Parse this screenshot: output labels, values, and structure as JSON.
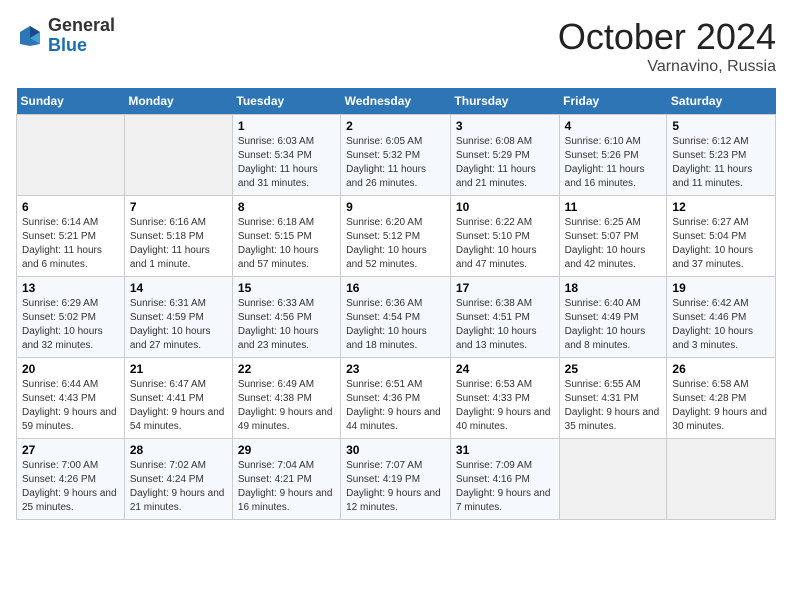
{
  "header": {
    "logo_general": "General",
    "logo_blue": "Blue",
    "month_title": "October 2024",
    "subtitle": "Varnavino, Russia"
  },
  "days_of_week": [
    "Sunday",
    "Monday",
    "Tuesday",
    "Wednesday",
    "Thursday",
    "Friday",
    "Saturday"
  ],
  "weeks": [
    [
      {
        "day": "",
        "sunrise": "",
        "sunset": "",
        "daylight": ""
      },
      {
        "day": "",
        "sunrise": "",
        "sunset": "",
        "daylight": ""
      },
      {
        "day": "1",
        "sunrise": "Sunrise: 6:03 AM",
        "sunset": "Sunset: 5:34 PM",
        "daylight": "Daylight: 11 hours and 31 minutes."
      },
      {
        "day": "2",
        "sunrise": "Sunrise: 6:05 AM",
        "sunset": "Sunset: 5:32 PM",
        "daylight": "Daylight: 11 hours and 26 minutes."
      },
      {
        "day": "3",
        "sunrise": "Sunrise: 6:08 AM",
        "sunset": "Sunset: 5:29 PM",
        "daylight": "Daylight: 11 hours and 21 minutes."
      },
      {
        "day": "4",
        "sunrise": "Sunrise: 6:10 AM",
        "sunset": "Sunset: 5:26 PM",
        "daylight": "Daylight: 11 hours and 16 minutes."
      },
      {
        "day": "5",
        "sunrise": "Sunrise: 6:12 AM",
        "sunset": "Sunset: 5:23 PM",
        "daylight": "Daylight: 11 hours and 11 minutes."
      }
    ],
    [
      {
        "day": "6",
        "sunrise": "Sunrise: 6:14 AM",
        "sunset": "Sunset: 5:21 PM",
        "daylight": "Daylight: 11 hours and 6 minutes."
      },
      {
        "day": "7",
        "sunrise": "Sunrise: 6:16 AM",
        "sunset": "Sunset: 5:18 PM",
        "daylight": "Daylight: 11 hours and 1 minute."
      },
      {
        "day": "8",
        "sunrise": "Sunrise: 6:18 AM",
        "sunset": "Sunset: 5:15 PM",
        "daylight": "Daylight: 10 hours and 57 minutes."
      },
      {
        "day": "9",
        "sunrise": "Sunrise: 6:20 AM",
        "sunset": "Sunset: 5:12 PM",
        "daylight": "Daylight: 10 hours and 52 minutes."
      },
      {
        "day": "10",
        "sunrise": "Sunrise: 6:22 AM",
        "sunset": "Sunset: 5:10 PM",
        "daylight": "Daylight: 10 hours and 47 minutes."
      },
      {
        "day": "11",
        "sunrise": "Sunrise: 6:25 AM",
        "sunset": "Sunset: 5:07 PM",
        "daylight": "Daylight: 10 hours and 42 minutes."
      },
      {
        "day": "12",
        "sunrise": "Sunrise: 6:27 AM",
        "sunset": "Sunset: 5:04 PM",
        "daylight": "Daylight: 10 hours and 37 minutes."
      }
    ],
    [
      {
        "day": "13",
        "sunrise": "Sunrise: 6:29 AM",
        "sunset": "Sunset: 5:02 PM",
        "daylight": "Daylight: 10 hours and 32 minutes."
      },
      {
        "day": "14",
        "sunrise": "Sunrise: 6:31 AM",
        "sunset": "Sunset: 4:59 PM",
        "daylight": "Daylight: 10 hours and 27 minutes."
      },
      {
        "day": "15",
        "sunrise": "Sunrise: 6:33 AM",
        "sunset": "Sunset: 4:56 PM",
        "daylight": "Daylight: 10 hours and 23 minutes."
      },
      {
        "day": "16",
        "sunrise": "Sunrise: 6:36 AM",
        "sunset": "Sunset: 4:54 PM",
        "daylight": "Daylight: 10 hours and 18 minutes."
      },
      {
        "day": "17",
        "sunrise": "Sunrise: 6:38 AM",
        "sunset": "Sunset: 4:51 PM",
        "daylight": "Daylight: 10 hours and 13 minutes."
      },
      {
        "day": "18",
        "sunrise": "Sunrise: 6:40 AM",
        "sunset": "Sunset: 4:49 PM",
        "daylight": "Daylight: 10 hours and 8 minutes."
      },
      {
        "day": "19",
        "sunrise": "Sunrise: 6:42 AM",
        "sunset": "Sunset: 4:46 PM",
        "daylight": "Daylight: 10 hours and 3 minutes."
      }
    ],
    [
      {
        "day": "20",
        "sunrise": "Sunrise: 6:44 AM",
        "sunset": "Sunset: 4:43 PM",
        "daylight": "Daylight: 9 hours and 59 minutes."
      },
      {
        "day": "21",
        "sunrise": "Sunrise: 6:47 AM",
        "sunset": "Sunset: 4:41 PM",
        "daylight": "Daylight: 9 hours and 54 minutes."
      },
      {
        "day": "22",
        "sunrise": "Sunrise: 6:49 AM",
        "sunset": "Sunset: 4:38 PM",
        "daylight": "Daylight: 9 hours and 49 minutes."
      },
      {
        "day": "23",
        "sunrise": "Sunrise: 6:51 AM",
        "sunset": "Sunset: 4:36 PM",
        "daylight": "Daylight: 9 hours and 44 minutes."
      },
      {
        "day": "24",
        "sunrise": "Sunrise: 6:53 AM",
        "sunset": "Sunset: 4:33 PM",
        "daylight": "Daylight: 9 hours and 40 minutes."
      },
      {
        "day": "25",
        "sunrise": "Sunrise: 6:55 AM",
        "sunset": "Sunset: 4:31 PM",
        "daylight": "Daylight: 9 hours and 35 minutes."
      },
      {
        "day": "26",
        "sunrise": "Sunrise: 6:58 AM",
        "sunset": "Sunset: 4:28 PM",
        "daylight": "Daylight: 9 hours and 30 minutes."
      }
    ],
    [
      {
        "day": "27",
        "sunrise": "Sunrise: 7:00 AM",
        "sunset": "Sunset: 4:26 PM",
        "daylight": "Daylight: 9 hours and 25 minutes."
      },
      {
        "day": "28",
        "sunrise": "Sunrise: 7:02 AM",
        "sunset": "Sunset: 4:24 PM",
        "daylight": "Daylight: 9 hours and 21 minutes."
      },
      {
        "day": "29",
        "sunrise": "Sunrise: 7:04 AM",
        "sunset": "Sunset: 4:21 PM",
        "daylight": "Daylight: 9 hours and 16 minutes."
      },
      {
        "day": "30",
        "sunrise": "Sunrise: 7:07 AM",
        "sunset": "Sunset: 4:19 PM",
        "daylight": "Daylight: 9 hours and 12 minutes."
      },
      {
        "day": "31",
        "sunrise": "Sunrise: 7:09 AM",
        "sunset": "Sunset: 4:16 PM",
        "daylight": "Daylight: 9 hours and 7 minutes."
      },
      {
        "day": "",
        "sunrise": "",
        "sunset": "",
        "daylight": ""
      },
      {
        "day": "",
        "sunrise": "",
        "sunset": "",
        "daylight": ""
      }
    ]
  ]
}
